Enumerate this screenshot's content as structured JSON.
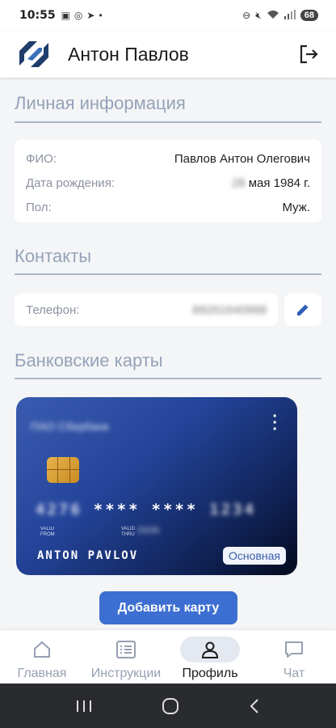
{
  "status_bar": {
    "time": "10:55",
    "battery": "68"
  },
  "header": {
    "title": "Антон Павлов"
  },
  "personal": {
    "title": "Личная информация",
    "rows": [
      {
        "label": "ФИО:",
        "value": "Павлов Антон Олегович"
      },
      {
        "label": "Дата рождения:",
        "value_hidden": "28",
        "value": "мая 1984 г."
      },
      {
        "label": "Пол:",
        "value": "Муж."
      }
    ]
  },
  "contacts": {
    "title": "Контакты",
    "phone_label": "Телефон:",
    "phone_value": "89261640968"
  },
  "bank_cards": {
    "title": "Банковские карты",
    "card": {
      "bank_name": "ПАО Сбербанк",
      "number_groups": [
        "4276",
        "****",
        "****",
        "1234"
      ],
      "valid_from_label": "VALID FROM",
      "valid_thru_label": "VALID THRU",
      "valid_thru_value": "03/30",
      "holder": "ANTON PAVLOV",
      "badge": "Основная"
    },
    "add_button": "Добавить карту"
  },
  "bottom_nav": [
    {
      "label": "Главная",
      "icon": "home-icon",
      "active": false
    },
    {
      "label": "Инструкции",
      "icon": "instructions-icon",
      "active": false
    },
    {
      "label": "Профиль",
      "icon": "profile-icon",
      "active": true
    },
    {
      "label": "Чат",
      "icon": "chat-icon",
      "active": false
    }
  ],
  "colors": {
    "accent": "#3c6fd1",
    "section_title": "#95a2b8",
    "nav_active_bg": "#e4e8f1"
  }
}
